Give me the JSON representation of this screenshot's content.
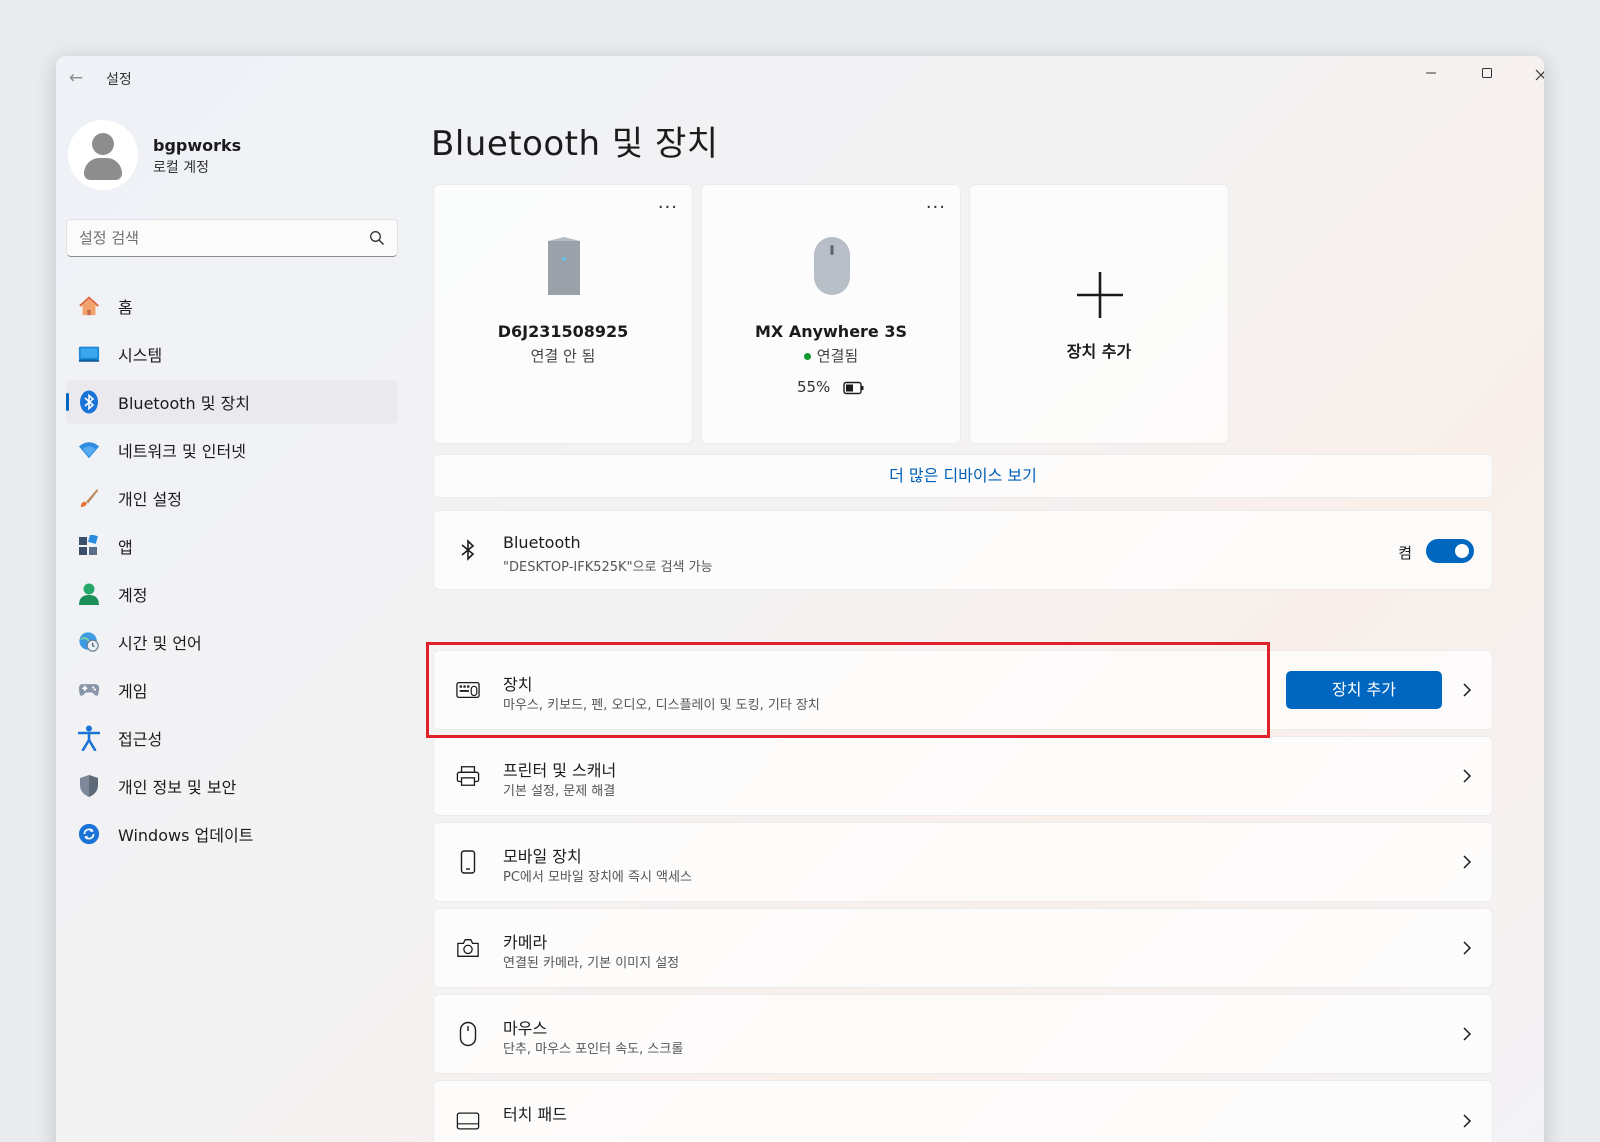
{
  "window": {
    "title": "설정",
    "back_icon": "back-arrow-icon",
    "controls": [
      "minimize",
      "maximize",
      "close"
    ]
  },
  "account": {
    "name": "bgpworks",
    "type": "로컬 계정"
  },
  "search": {
    "placeholder": "설정 검색"
  },
  "nav": {
    "items": [
      {
        "label": "홈",
        "icon": "home-icon",
        "active": false
      },
      {
        "label": "시스템",
        "icon": "system-icon",
        "active": false
      },
      {
        "label": "Bluetooth 및 장치",
        "icon": "bluetooth-icon",
        "active": true
      },
      {
        "label": "네트워크 및 인터넷",
        "icon": "wifi-icon",
        "active": false
      },
      {
        "label": "개인 설정",
        "icon": "brush-icon",
        "active": false
      },
      {
        "label": "앱",
        "icon": "apps-icon",
        "active": false
      },
      {
        "label": "계정",
        "icon": "account-icon",
        "active": false
      },
      {
        "label": "시간 및 언어",
        "icon": "globe-clock-icon",
        "active": false
      },
      {
        "label": "게임",
        "icon": "gamepad-icon",
        "active": false
      },
      {
        "label": "접근성",
        "icon": "accessibility-icon",
        "active": false
      },
      {
        "label": "개인 정보 및 보안",
        "icon": "shield-icon",
        "active": false
      },
      {
        "label": "Windows 업데이트",
        "icon": "update-icon",
        "active": false
      }
    ]
  },
  "main": {
    "title": "Bluetooth 및 장치",
    "devices": [
      {
        "name": "D6J231508925",
        "status": "연결 안 됨",
        "icon": "tower-device-icon",
        "more": "···"
      },
      {
        "name": "MX Anywhere 3S",
        "status": "연결됨",
        "battery": "55%",
        "icon": "mouse-device-icon",
        "more": "···"
      }
    ],
    "add_card_label": "장치 추가",
    "more_devices": "더 많은 디바이스 보기",
    "bluetooth": {
      "title": "Bluetooth",
      "subtitle": "\"DESKTOP-IFK525K\"으로 검색 가능",
      "state": "켬",
      "enabled": true
    },
    "rows": [
      {
        "title": "장치",
        "subtitle": "마우스, 키보드, 펜, 오디오, 디스플레이 및 도킹, 기타 장치",
        "icon": "devices-icon",
        "button": "장치 추가"
      },
      {
        "title": "프린터 및 스캐너",
        "subtitle": "기본 설정, 문제 해결",
        "icon": "printer-icon"
      },
      {
        "title": "모바일 장치",
        "subtitle": "PC에서 모바일 장치에 즉시 액세스",
        "icon": "phone-icon"
      },
      {
        "title": "카메라",
        "subtitle": "연결된 카메라, 기본 이미지 설정",
        "icon": "camera-icon"
      },
      {
        "title": "마우스",
        "subtitle": "단추, 마우스 포인터 속도, 스크롤",
        "icon": "mouse-icon"
      },
      {
        "title": "터치 패드",
        "subtitle": "",
        "icon": "touchpad-icon"
      }
    ]
  },
  "colors": {
    "accent": "#0067c0",
    "link": "#005fb8",
    "highlight_box": "#e0202a",
    "connected_dot": "#109a2d"
  }
}
